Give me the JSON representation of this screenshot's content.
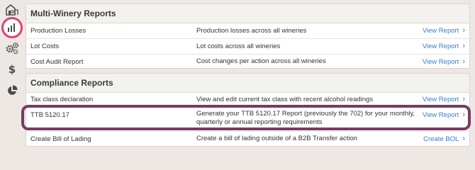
{
  "sidebar": {
    "icons": [
      "winery-icon",
      "bar-chart-icon",
      "gears-icon",
      "dollar-icon",
      "pie-chart-icon"
    ],
    "dollar_glyph": "$",
    "active_color": "#e0407a"
  },
  "multi_winery": {
    "title": "Multi-Winery Reports",
    "rows": [
      {
        "name": "Production Losses",
        "desc": "Production losses across all wineries",
        "link": "View Report"
      },
      {
        "name": "Lot Costs",
        "desc": "Lot costs across all wineries",
        "link": "View Report"
      },
      {
        "name": "Cost Audit Report",
        "desc": "Cost changes per action across all wineries",
        "link": "View Report"
      }
    ]
  },
  "compliance": {
    "title": "Compliance Reports",
    "rows": [
      {
        "name": "Tax class declaration",
        "desc": "View and edit current tax class with recent alcohol readings",
        "link": "View Report"
      },
      {
        "name": "TTB 5120.17",
        "desc": "Generate your TTB 5120.17 Report (previously the 702) for your monthly, quarterly or annual reporting requirements",
        "link": "View Report"
      },
      {
        "name": "Create Bill of Lading",
        "desc": "Create a bill of lading outside of a B2B Transfer action",
        "link": "Create BOL"
      }
    ]
  },
  "chevron": "›",
  "colors": {
    "link": "#3b7ec7",
    "highlight": "#7a3a60",
    "background": "#ede8e3"
  }
}
